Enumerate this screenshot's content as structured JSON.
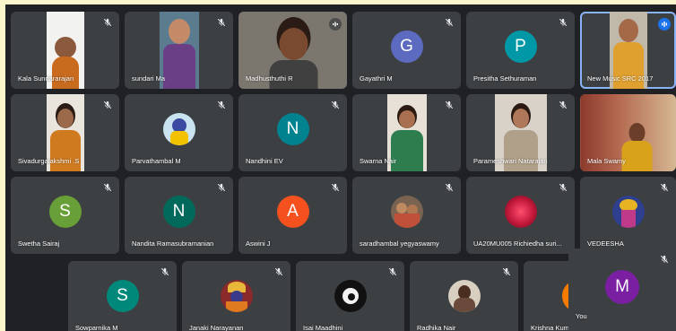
{
  "participants": {
    "kala": "Kala Sundararajan",
    "sundari": "sundari Ma",
    "madhusthuthi": "Madhusthuthi R",
    "gayathri": "Gayathri M",
    "presitha": "Presitha Sethuraman",
    "newmusic": "New Music SRC 2017",
    "sivadurga": "Sivadurgalakshmi .S",
    "parvatham": "Parvathambal M",
    "nandhini": "Nandhini EV",
    "swarna": "Swarna Nair",
    "parameshwari": "Parameshwari Natarajan",
    "mala": "Mala Swamy",
    "swetha": "Swetha Sairaj",
    "nandita": "Nandita Ramasubramanian",
    "aswini": "Aswini J",
    "saradhambal": "saradhambal yegyaswamy",
    "ua20mu": "UA20MU005 Richiedha suri...",
    "vedeesha": "VEDEESHA",
    "sowparnika": "Sowparnika M",
    "janaki": "Janaki Narayanan",
    "isai": "Isai Maadhini",
    "radhika": "Radhika Nair",
    "krishna": "Krishna Kum",
    "you": "You"
  },
  "initials": {
    "gayathri": "G",
    "presitha": "P",
    "nandhini": "N",
    "swetha": "S",
    "nandita": "N",
    "aswini": "A",
    "sowparnika": "S",
    "you": "M"
  },
  "colors": {
    "gayathri": "#5c6bc0",
    "presitha": "#0097a7",
    "nandhini": "#00838f",
    "swetha": "#689f38",
    "nandita": "#00695c",
    "aswini": "#f4511e",
    "sowparnika": "#00897b",
    "krishna": "#f57c00",
    "you": "#7b1fa2"
  },
  "icons": {
    "mute": "mic-off-icon",
    "speaking": "audio-level-icon"
  }
}
